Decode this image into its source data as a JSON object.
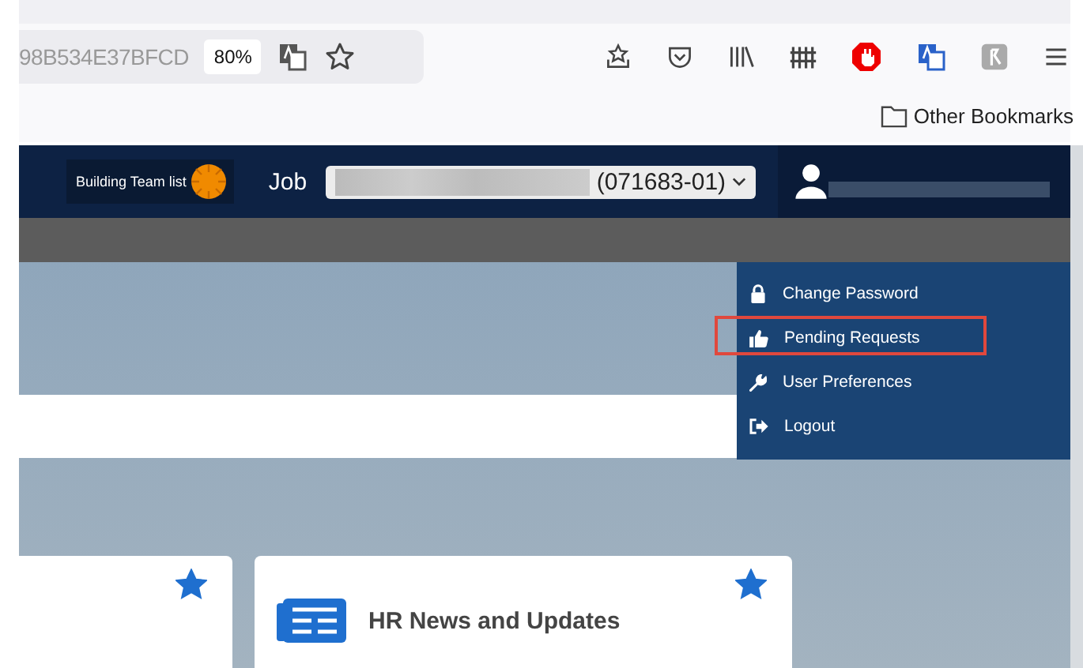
{
  "browser": {
    "url": "98B534E37BFCD",
    "zoom": "80%",
    "bookmarks": [
      "Other Bookmarks"
    ]
  },
  "header": {
    "badge": "Building Team list",
    "job_label": "Job",
    "job_value": "(071683-01)"
  },
  "user_menu": {
    "items": [
      {
        "label": "Change Password",
        "kind": "lock",
        "highlighted": false
      },
      {
        "label": "Pending Requests",
        "kind": "thumb",
        "highlighted": true
      },
      {
        "label": "User Preferences",
        "kind": "wrench",
        "highlighted": false
      },
      {
        "label": "Logout",
        "kind": "logout",
        "highlighted": false
      }
    ]
  },
  "cards": [
    {
      "favorite": true
    },
    {
      "title": "HR News and Updates",
      "favorite": true
    }
  ]
}
